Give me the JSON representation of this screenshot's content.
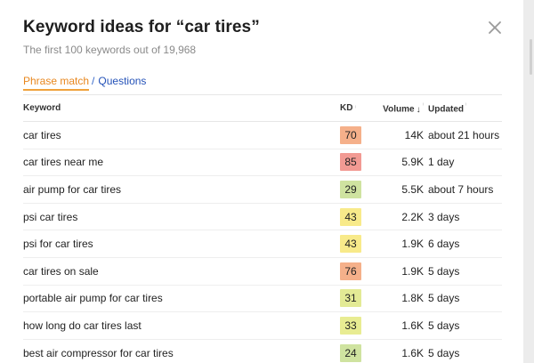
{
  "modal": {
    "title": "Keyword ideas for “car tires”",
    "subtitle": "The first 100 keywords out of 19,968",
    "close_icon": "close-icon"
  },
  "tabs": {
    "active": "Phrase match",
    "separator": "/",
    "other": "Questions",
    "active_color": "#e8871e",
    "link_color": "#2452b8"
  },
  "table": {
    "headers": {
      "keyword": "Keyword",
      "kd": "KD",
      "volume": "Volume",
      "updated": "Updated"
    },
    "rows": [
      {
        "keyword": "car tires",
        "kd": "70",
        "kd_color": "#f5b08a",
        "volume": "14K",
        "updated": "about 21 hours"
      },
      {
        "keyword": "car tires near me",
        "kd": "85",
        "kd_color": "#f29a93",
        "volume": "5.9K",
        "updated": "1 day"
      },
      {
        "keyword": "air pump for car tires",
        "kd": "29",
        "kd_color": "#cfe3a0",
        "volume": "5.5K",
        "updated": "about 7 hours"
      },
      {
        "keyword": "psi car tires",
        "kd": "43",
        "kd_color": "#f8ea8a",
        "volume": "2.2K",
        "updated": "3 days"
      },
      {
        "keyword": "psi for car tires",
        "kd": "43",
        "kd_color": "#f8ea8a",
        "volume": "1.9K",
        "updated": "6 days"
      },
      {
        "keyword": "car tires on sale",
        "kd": "76",
        "kd_color": "#f5b08a",
        "volume": "1.9K",
        "updated": "5 days"
      },
      {
        "keyword": "portable air pump for car tires",
        "kd": "31",
        "kd_color": "#e3ea95",
        "volume": "1.8K",
        "updated": "5 days"
      },
      {
        "keyword": "how long do car tires last",
        "kd": "33",
        "kd_color": "#e8ec92",
        "volume": "1.6K",
        "updated": "5 days"
      },
      {
        "keyword": "best air compressor for car tires",
        "kd": "24",
        "kd_color": "#cfe3a0",
        "volume": "1.6K",
        "updated": "5 days"
      }
    ]
  }
}
